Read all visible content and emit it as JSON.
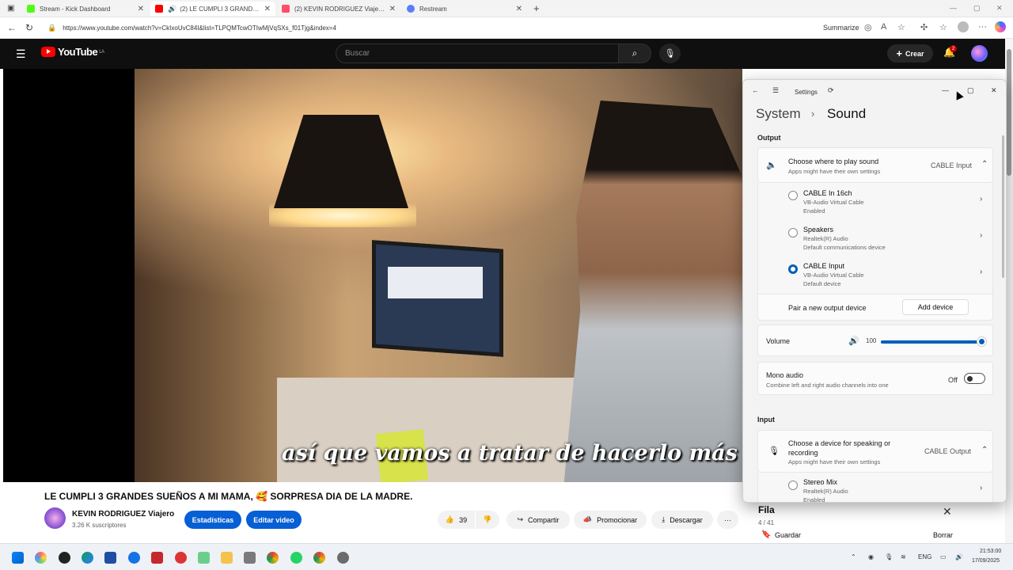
{
  "browser": {
    "tabs": [
      {
        "title": "Stream - Kick Dashboard",
        "favicon_color": "#53fc18",
        "active": false
      },
      {
        "title": "(2) LE CUMPLI 3 GRANDES S",
        "favicon_color": "#ff0000",
        "active": true
      },
      {
        "title": "(2) KEVIN RODRIGUEZ Viajero - Yo",
        "favicon_color": "#ff4e6a",
        "active": false
      },
      {
        "title": "Restream",
        "favicon_color": "#5b7cfa",
        "active": false
      }
    ],
    "url": "https://www.youtube.com/watch?v=CkIxoUvC84I&list=TLPQMTcwOTIwMjVqSXs_f01Tjg&index=4",
    "summarize_label": "Summarize"
  },
  "youtube": {
    "logo_text": "YouTube",
    "logo_region": "LA",
    "search_placeholder": "Buscar",
    "create_label": "Crear",
    "notification_count": "2",
    "subtitle": "así que vamos a tratar de hacerlo más fácil",
    "video_title": "LE CUMPLI 3 GRANDES SUEÑOS A MI MAMA, 🥰 SORPRESA DIA DE LA MADRE.",
    "channel_name": "KEVIN RODRIGUEZ Viajero",
    "subscribers": "3.26 K suscriptores",
    "stats_label": "Estadísticas",
    "edit_label": "Editar video",
    "like_count": "39",
    "share_label": "Compartir",
    "promote_label": "Promocionar",
    "download_label": "Descargar",
    "more_label": "···",
    "queue": {
      "title": "Fila",
      "position": "4 / 41",
      "save_label": "Guardar",
      "clear_label": "Borrar"
    }
  },
  "settings": {
    "window_title": "Settings",
    "breadcrumb_parent": "System",
    "breadcrumb_current": "Sound",
    "output_header": "Output",
    "output_choose_title": "Choose where to play sound",
    "output_choose_sub": "Apps might have their own settings",
    "output_selected": "CABLE Input",
    "output_devices": [
      {
        "name": "CABLE In 16ch",
        "driver": "VB-Audio Virtual Cable",
        "status": "Enabled",
        "selected": false
      },
      {
        "name": "Speakers",
        "driver": "Realtek(R) Audio",
        "status": "Default communications device",
        "selected": false
      },
      {
        "name": "CABLE Input",
        "driver": "VB-Audio Virtual Cable",
        "status": "Default device",
        "selected": true
      }
    ],
    "pair_label": "Pair a new output device",
    "add_device_label": "Add device",
    "volume_label": "Volume",
    "volume_value": "100",
    "volume_fraction": 1.0,
    "mono_title": "Mono audio",
    "mono_sub": "Combine left and right audio channels into one",
    "mono_state": "Off",
    "input_header": "Input",
    "input_choose_title": "Choose a device for speaking or recording",
    "input_choose_sub": "Apps might have their own settings",
    "input_selected": "CABLE Output",
    "input_devices": [
      {
        "name": "Stereo Mix",
        "driver": "Realtek(R) Audio",
        "status": "Enabled",
        "selected": false
      }
    ]
  },
  "taskbar": {
    "language": "ENG",
    "time": "21:53:00",
    "date": "17/09/2025"
  }
}
